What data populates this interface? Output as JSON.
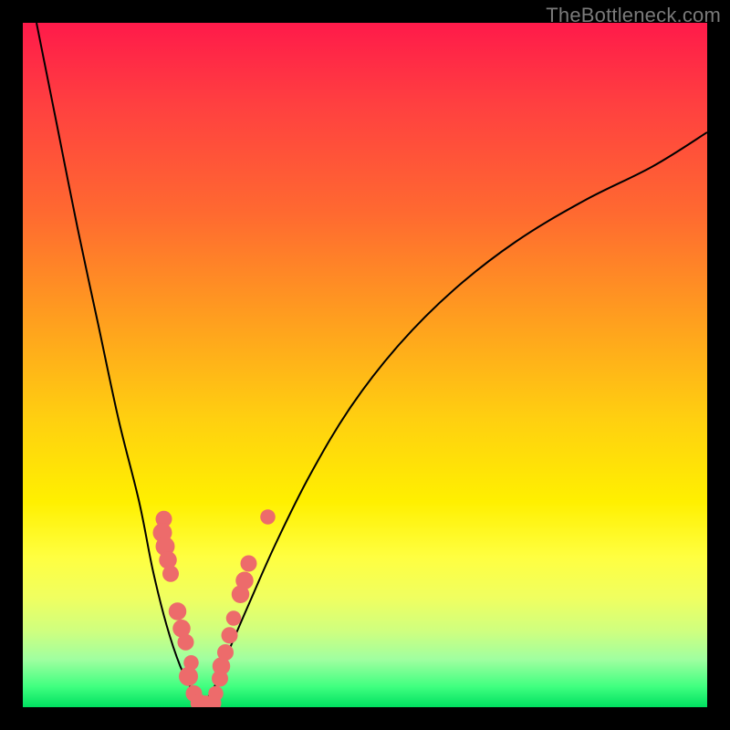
{
  "watermark": "TheBottleneck.com",
  "colors": {
    "frame": "#000000",
    "curve": "#000000",
    "marker": "#ed6b6b",
    "gradient_top": "#ff1a4a",
    "gradient_bottom": "#00e060"
  },
  "chart_data": {
    "type": "line",
    "title": "",
    "xlabel": "",
    "ylabel": "",
    "xlim": [
      0,
      100
    ],
    "ylim": [
      0,
      100
    ],
    "note": "V-shaped bottleneck curve. x is relative horizontal position (0=left edge of plot, 100=right). y is relative vertical position (0=bottom/green, 100=top/red). Left branch descends steeply from off-chart top-left to the valley near x≈25,y≈0; right branch rises with decreasing slope toward x≈100,y≈84.",
    "series": [
      {
        "name": "left-branch",
        "x": [
          2,
          5,
          8,
          11,
          14,
          17,
          19,
          21,
          23,
          25,
          26
        ],
        "y": [
          100,
          85,
          70,
          56,
          42,
          30,
          20,
          12,
          6,
          2,
          0
        ]
      },
      {
        "name": "right-branch",
        "x": [
          26,
          28,
          30,
          33,
          37,
          42,
          48,
          55,
          63,
          72,
          82,
          92,
          100
        ],
        "y": [
          0,
          3,
          8,
          15,
          24,
          34,
          44,
          53,
          61,
          68,
          74,
          79,
          84
        ]
      }
    ],
    "markers": {
      "name": "data-points",
      "note": "Salmon circular markers clustered near the valley and along the lower portions of both branches.",
      "points": [
        {
          "x": 20.6,
          "y": 27.5,
          "r": 1.2
        },
        {
          "x": 20.4,
          "y": 25.5,
          "r": 1.4
        },
        {
          "x": 20.8,
          "y": 23.5,
          "r": 1.4
        },
        {
          "x": 21.2,
          "y": 21.5,
          "r": 1.3
        },
        {
          "x": 21.6,
          "y": 19.5,
          "r": 1.2
        },
        {
          "x": 22.6,
          "y": 14.0,
          "r": 1.3
        },
        {
          "x": 23.2,
          "y": 11.5,
          "r": 1.3
        },
        {
          "x": 23.8,
          "y": 9.5,
          "r": 1.2
        },
        {
          "x": 24.6,
          "y": 6.5,
          "r": 1.1
        },
        {
          "x": 24.2,
          "y": 4.5,
          "r": 1.4
        },
        {
          "x": 25.0,
          "y": 2.0,
          "r": 1.2
        },
        {
          "x": 25.8,
          "y": 0.6,
          "r": 1.3
        },
        {
          "x": 26.8,
          "y": 0.4,
          "r": 1.3
        },
        {
          "x": 27.8,
          "y": 0.6,
          "r": 1.2
        },
        {
          "x": 28.2,
          "y": 2.0,
          "r": 1.1
        },
        {
          "x": 28.8,
          "y": 4.2,
          "r": 1.2
        },
        {
          "x": 29.0,
          "y": 6.0,
          "r": 1.3
        },
        {
          "x": 29.6,
          "y": 8.0,
          "r": 1.2
        },
        {
          "x": 30.2,
          "y": 10.5,
          "r": 1.2
        },
        {
          "x": 30.8,
          "y": 13.0,
          "r": 1.1
        },
        {
          "x": 31.8,
          "y": 16.5,
          "r": 1.3
        },
        {
          "x": 32.4,
          "y": 18.5,
          "r": 1.3
        },
        {
          "x": 33.0,
          "y": 21.0,
          "r": 1.2
        },
        {
          "x": 35.8,
          "y": 27.8,
          "r": 1.1
        }
      ]
    }
  }
}
